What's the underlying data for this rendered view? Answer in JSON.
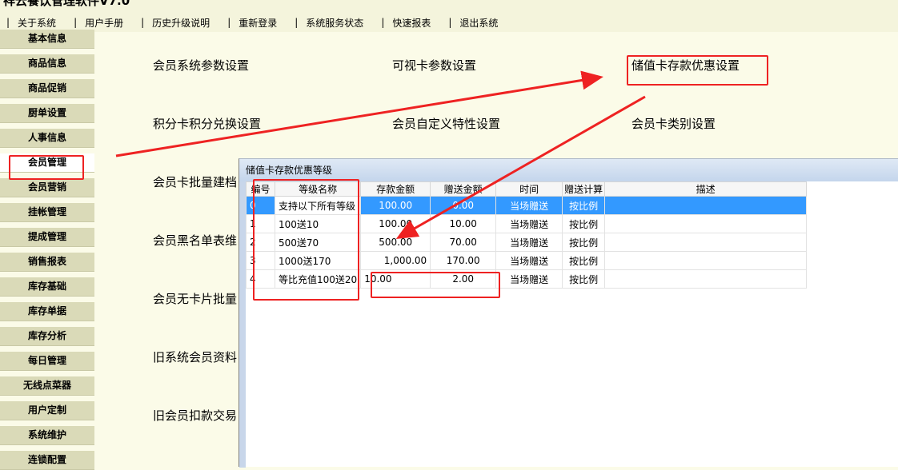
{
  "app": {
    "title": "祥云餐饮管理软件V7.0"
  },
  "menu": {
    "items": [
      "关于系统",
      "用户手册",
      "历史升级说明",
      "重新登录",
      "系统服务状态",
      "快速报表",
      "退出系统"
    ],
    "separator": "|"
  },
  "sidebar": {
    "items": [
      "基本信息",
      "商品信息",
      "商品促销",
      "厨单设置",
      "人事信息",
      "会员管理",
      "会员营销",
      "挂帐管理",
      "提成管理",
      "销售报表",
      "库存基础",
      "库存单据",
      "库存分析",
      "每日管理",
      "无线点菜器",
      "用户定制",
      "系统维护",
      "连锁配置"
    ],
    "active": "会员管理"
  },
  "options": {
    "row1": [
      "会员系统参数设置",
      "可视卡参数设置",
      "储值卡存款优惠设置"
    ],
    "row2": [
      "积分卡积分兑换设置",
      "会员自定义特性设置",
      "会员卡类别设置"
    ],
    "col1_rest": [
      "会员卡批量建档",
      "会员黑名单表维",
      "会员无卡片批量",
      "旧系统会员资料",
      "旧会员扣款交易"
    ]
  },
  "dialog": {
    "title": "储值卡存款优惠等级",
    "columns": [
      "编号",
      "等级名称",
      "存款金额",
      "赠送金额",
      "时间",
      "赠送计算",
      "描述"
    ],
    "rows": [
      [
        "0",
        "支持以下所有等级",
        "100.00",
        "0.00",
        "当场赠送",
        "按比例",
        ""
      ],
      [
        "1",
        "100送10",
        "100.00",
        "10.00",
        "当场赠送",
        "按比例",
        ""
      ],
      [
        "2",
        "500送70",
        "500.00",
        "70.00",
        "当场赠送",
        "按比例",
        ""
      ],
      [
        "3",
        "1000送170",
        "1,000.00",
        "170.00",
        "当场赠送",
        "按比例",
        ""
      ],
      [
        "4",
        "等比充值100送20",
        "10.00",
        "2.00",
        "当场赠送",
        "按比例",
        ""
      ]
    ],
    "selected_row": 0
  },
  "colors": {
    "background": "#fbfbe8",
    "sidebar": "#dadab8",
    "selection": "#3399ff",
    "annotation": "#ee2222"
  }
}
